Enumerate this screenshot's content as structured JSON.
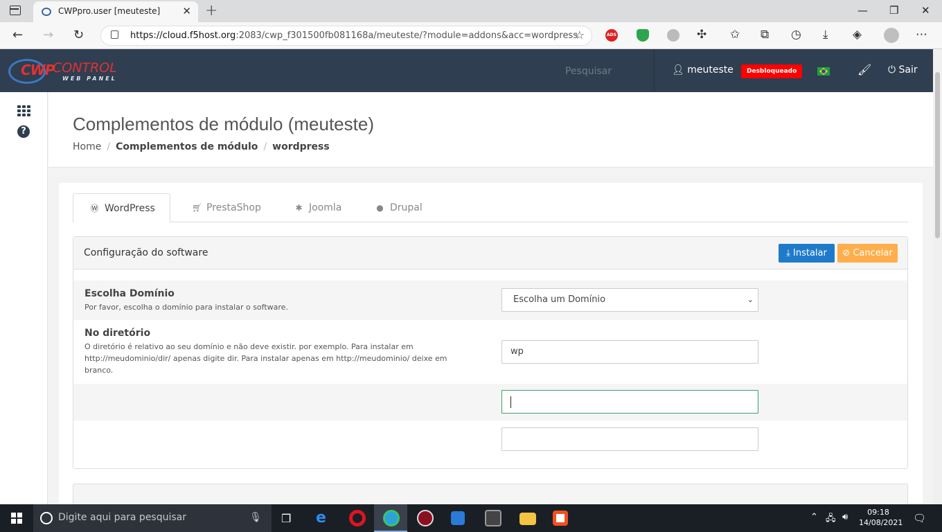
{
  "browser": {
    "tab_title": "CWPpro.user [meuteste]",
    "tab_close": "✕",
    "new_tab": "+",
    "url_host": "https://cloud.f5host.org",
    "url_rest": ":2083/cwp_f301500fb081168a/meuteste/?module=addons&acc=wordpress",
    "window_controls": [
      "—",
      "❐",
      "✕"
    ],
    "ext_ads_label": "ADS"
  },
  "header": {
    "logo_cwp": "CWP",
    "logo_control": "CONTROL",
    "logo_webpanel": "WEB PANEL",
    "search": "Pesquisar",
    "username": "meuteste",
    "status_badge": "Desbloqueado",
    "logout": "Sair",
    "colors": {
      "header_bg": "#2f3e50",
      "badge": "#ff0000"
    }
  },
  "page": {
    "title": "Complementos de módulo (meuteste)",
    "breadcrumb": [
      "Home",
      "Complementos de módulo",
      "wordpress"
    ]
  },
  "tabs": [
    {
      "label": "WordPress",
      "icon": "wordpress-icon",
      "active": true
    },
    {
      "label": "PrestaShop",
      "icon": "cart-icon",
      "active": false
    },
    {
      "label": "Joomla",
      "icon": "joomla-icon",
      "active": false
    },
    {
      "label": "Drupal",
      "icon": "drupal-icon",
      "active": false
    }
  ],
  "panel": {
    "title": "Configuração do software",
    "install": "Instalar",
    "cancel": "Cancelar",
    "domain": {
      "label": "Escolha Domínio",
      "help": "Por favor, escolha o domínio para instalar o software.",
      "selected": "Escolha um Domínio"
    },
    "directory": {
      "label": "No diretório",
      "help": "O diretório é relativo ao seu domínio e não deve existir. por exemplo. Para instalar em http://meudominio/dir/ apenas digite dir. Para instalar apenas em http://meudominio/ deixe em branco.",
      "value": "wp"
    },
    "field3_value": "",
    "field4_value": ""
  },
  "taskbar": {
    "search_placeholder": "Digite aqui para pesquisar",
    "time": "09:18",
    "date": "14/08/2021"
  }
}
